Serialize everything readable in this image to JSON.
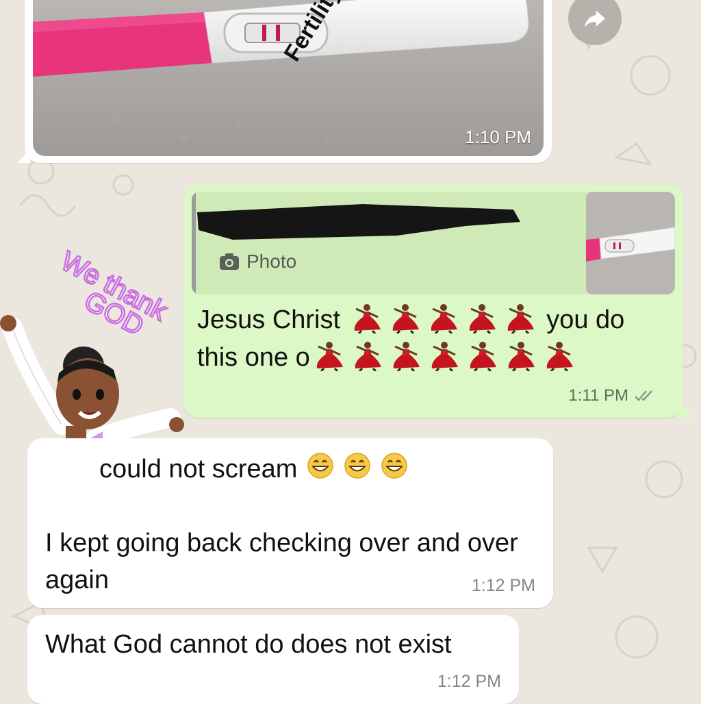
{
  "photo_message": {
    "watermark": "Fertilityw",
    "time": "1:10 PM"
  },
  "reply_message": {
    "quote_label": "Photo",
    "text_part1": "Jesus Christ",
    "text_part2": "you do",
    "text_part3": "this one o",
    "time": "1:11 PM"
  },
  "sticker": {
    "caption_line1": "We thank",
    "caption_line2": "GOD"
  },
  "message_1": {
    "line1": "could not scream",
    "body": "I kept going back checking over and over again",
    "time": "1:12 PM"
  },
  "message_2": {
    "body": "What God cannot do does not exist",
    "time": "1:12 PM"
  },
  "colors": {
    "wallpaper": "#ebe6de",
    "incoming_bubble": "#ffffff",
    "outgoing_bubble": "#dcf8c6",
    "sticker_caption": "#c86ee0"
  },
  "icons": [
    "forward-icon",
    "camera-icon",
    "double-check-icon",
    "dancer-emoji",
    "grinning-emoji"
  ]
}
